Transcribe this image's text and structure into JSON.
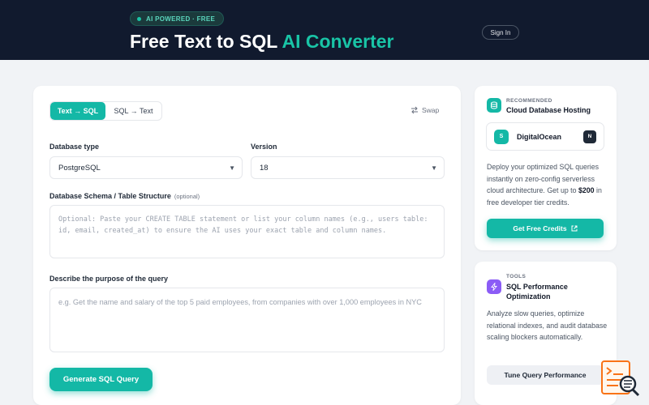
{
  "header": {
    "badge": "AI POWERED · FREE",
    "title_main": "Free Text to SQL ",
    "title_accent": "AI Converter",
    "sign_in": "Sign In"
  },
  "converter": {
    "tabs": [
      {
        "label": "Text → SQL",
        "active": true
      },
      {
        "label": "SQL → Text",
        "active": false
      }
    ],
    "swap_label": "Swap",
    "db_type": {
      "label": "Database type",
      "value": "PostgreSQL"
    },
    "version": {
      "label": "Version",
      "value": "18"
    },
    "schema": {
      "label": "Database Schema / Table Structure",
      "optional": "(optional)",
      "placeholder": "Optional: Paste your CREATE TABLE statement or list your column names (e.g., users table: id, email, created_at) to ensure the AI uses your exact table and column names."
    },
    "purpose": {
      "label": "Describe the purpose of the query",
      "placeholder": "e.g. Get the name and salary of the top 5 paid employees, from companies with over 1,000 employees in NYC"
    },
    "generate_button": "Generate SQL Query"
  },
  "sidebar": {
    "hosting": {
      "eyebrow": "RECOMMENDED",
      "title": "Cloud Database Hosting",
      "provider_initial": "S",
      "provider_name": "DigitalOcean",
      "provider_badge": "N",
      "desc_pre": "Deploy your optimized SQL queries instantly on zero-config serverless cloud architecture. Get up to ",
      "desc_bold": "$200",
      "desc_post": " in free developer tier credits.",
      "button": "Get Free Credits"
    },
    "tools": {
      "eyebrow": "TOOLS",
      "title": "SQL Performance Optimization",
      "desc": "Analyze slow queries, optimize relational indexes, and audit database scaling blockers automatically.",
      "button": "Tune Query Performance"
    }
  },
  "colors": {
    "brand": "#14b8a6",
    "header_bg": "#111a2e",
    "page_bg": "#f1f3f6",
    "tools_icon": "#8b5cf6",
    "logo": "#f97316"
  },
  "icons": [
    "swap-icon",
    "select-caret-icon",
    "database-icon",
    "bolt-icon",
    "external-link-icon",
    "site-logo-icon"
  ]
}
